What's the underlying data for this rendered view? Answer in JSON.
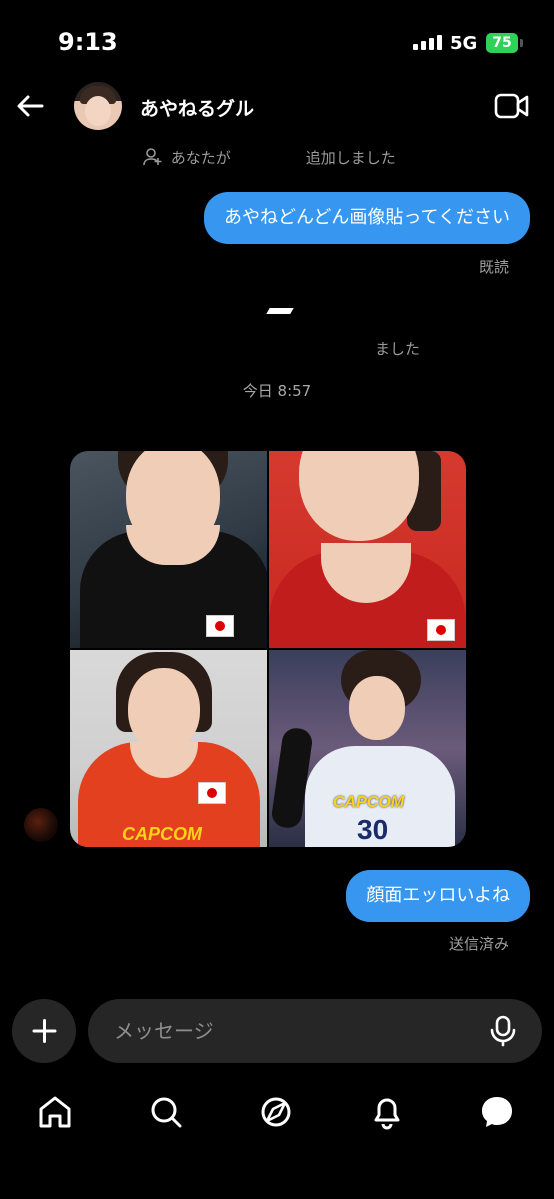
{
  "status_bar": {
    "time": "9:13",
    "network": "5G",
    "battery": "75"
  },
  "header": {
    "title": "あやねるグル"
  },
  "notices": {
    "member_added": "あなたが　　　　　追加しました",
    "photo_notice": "ました"
  },
  "messages": {
    "outgoing_1": {
      "text": "あやねどんどん画像貼ってください",
      "status": "既読"
    },
    "timestamp": "今日 8:57",
    "outgoing_2": {
      "text": "顔面エッロいよね",
      "status": "送信済み"
    }
  },
  "photo_grid": {
    "captions": [
      "JAPAN",
      "JAPAN",
      "CAPCOM",
      "CAPCOM",
      "30"
    ]
  },
  "composer": {
    "placeholder": "メッセージ"
  },
  "bottom_nav": {
    "items": [
      "home-icon",
      "search-icon",
      "explore-icon",
      "notifications-icon",
      "messages-icon"
    ]
  },
  "colors": {
    "accent": "#3797f0",
    "background": "#000000",
    "surface": "#262626",
    "battery": "#30d158"
  }
}
